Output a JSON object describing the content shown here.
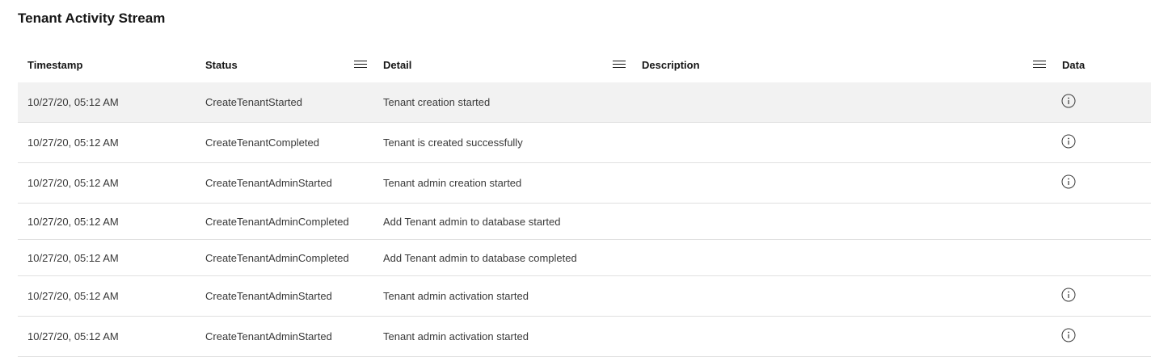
{
  "page": {
    "title": "Tenant Activity Stream"
  },
  "columns": {
    "timestamp": "Timestamp",
    "status": "Status",
    "detail": "Detail",
    "description": "Description",
    "data": "Data"
  },
  "colors": {
    "highlight_row": "#f2f2f2",
    "divider": "#e0e0e0",
    "text": "#393939"
  },
  "rows": [
    {
      "timestamp": "10/27/20, 05:12 AM",
      "status": "CreateTenantStarted",
      "detail": "Tenant creation started",
      "description": "",
      "has_data": true,
      "highlighted": true
    },
    {
      "timestamp": "10/27/20, 05:12 AM",
      "status": "CreateTenantCompleted",
      "detail": "Tenant is created successfully",
      "description": "",
      "has_data": true,
      "highlighted": false
    },
    {
      "timestamp": "10/27/20, 05:12 AM",
      "status": "CreateTenantAdminStarted",
      "detail": "Tenant admin creation started",
      "description": "",
      "has_data": true,
      "highlighted": false
    },
    {
      "timestamp": "10/27/20, 05:12 AM",
      "status": "CreateTenantAdminCompleted",
      "detail": "Add Tenant admin to database started",
      "description": "",
      "has_data": false,
      "highlighted": false
    },
    {
      "timestamp": "10/27/20, 05:12 AM",
      "status": "CreateTenantAdminCompleted",
      "detail": "Add Tenant admin to database completed",
      "description": "",
      "has_data": false,
      "highlighted": false
    },
    {
      "timestamp": "10/27/20, 05:12 AM",
      "status": "CreateTenantAdminStarted",
      "detail": "Tenant admin activation started",
      "description": "",
      "has_data": true,
      "highlighted": false
    },
    {
      "timestamp": "10/27/20, 05:12 AM",
      "status": "CreateTenantAdminStarted",
      "detail": "Tenant admin activation started",
      "description": "",
      "has_data": true,
      "highlighted": false
    }
  ]
}
